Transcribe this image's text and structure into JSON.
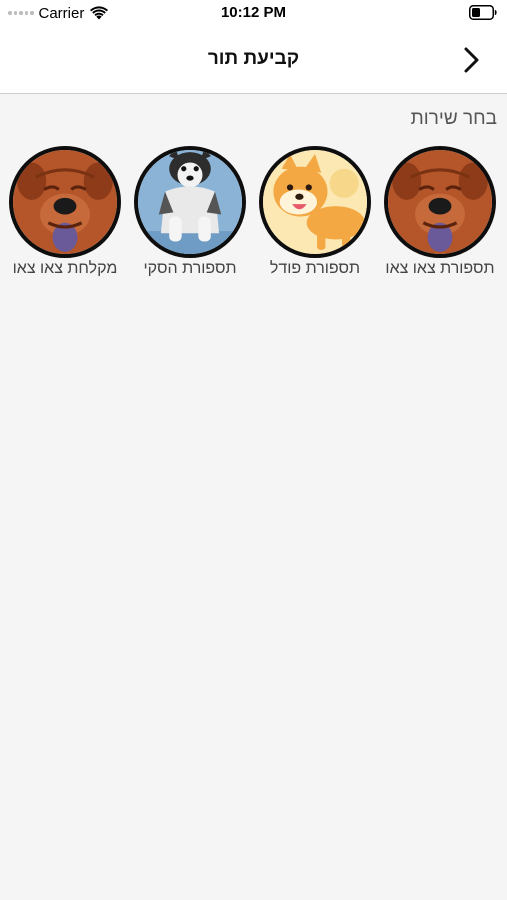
{
  "status_bar": {
    "carrier": "Carrier",
    "time": "10:12 PM"
  },
  "nav": {
    "title": "קביעת תור",
    "back_icon": "chevron-right-icon"
  },
  "section": {
    "label": "בחר שירות"
  },
  "services": [
    {
      "label": "תספורת צאו צאו",
      "image": "chow-chow-dog"
    },
    {
      "label": "תספורת פודל",
      "image": "shiba-corgi-dog"
    },
    {
      "label": "תספורת הסקי",
      "image": "husky-dog"
    },
    {
      "label": "מקלחת צאו צאו",
      "image": "chow-chow-dog"
    }
  ],
  "colors": {
    "background": "#f5f5f5",
    "bar": "#ffffff",
    "circle_border": "#0e0e0e",
    "chow_fur": "#b5562a",
    "husky_bg": "#8ab3d6",
    "shiba_bg": "#fbe8b3"
  }
}
